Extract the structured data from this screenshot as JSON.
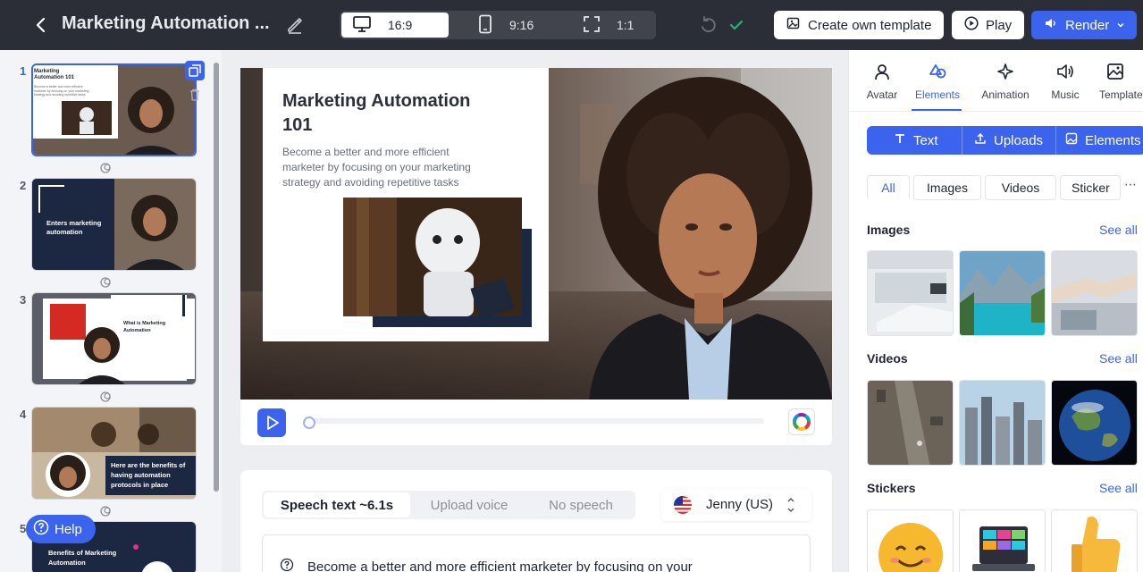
{
  "header": {
    "title": "Marketing Automation ...",
    "ratios": [
      {
        "icon": "monitor-icon",
        "label": "16:9"
      },
      {
        "icon": "phone-icon",
        "label": "9:16"
      },
      {
        "icon": "square-frame-icon",
        "label": "1:1"
      }
    ],
    "active_ratio": "16:9",
    "create_template_label": "Create own template",
    "play_label": "Play",
    "render_label": "Render"
  },
  "slides": {
    "numbers": [
      "1",
      "2",
      "3",
      "4",
      "5"
    ],
    "slide1": {
      "title": "Marketing Automation 101",
      "body": "Become a better and more efficient marketer by focusing on your marketing strategy and avoiding repetitive tasks"
    },
    "slide2": {
      "title": "Enters marketing automation"
    },
    "slide3": {
      "title": "What is Marketing Automation"
    },
    "slide4": {
      "title": "Here are the benefits of having automation protocols in place"
    },
    "slide5": {
      "title": "Benefits of Marketing Automation"
    },
    "help_label": "Help"
  },
  "canvas": {
    "title": "Marketing Automation 101",
    "subtitle": "Become a better and more efficient marketer by focusing on your marketing strategy and avoiding repetitive tasks"
  },
  "playback": {
    "progress": 0
  },
  "speech": {
    "tabs": [
      "Speech text ~6.1s",
      "Upload voice",
      "No speech"
    ],
    "active_tab": "Speech text ~6.1s",
    "voice": "Jenny (US)",
    "text": "Become a better and more efficient marketer by focusing on your"
  },
  "panel": {
    "tabs": [
      {
        "icon": "avatar-icon",
        "label": "Avatar"
      },
      {
        "icon": "elements-icon",
        "label": "Elements"
      },
      {
        "icon": "animation-icon",
        "label": "Animation"
      },
      {
        "icon": "music-icon",
        "label": "Music"
      },
      {
        "icon": "template-icon",
        "label": "Template"
      }
    ],
    "active_tab": "Elements",
    "segments": [
      "Text",
      "Uploads",
      "Elements"
    ],
    "filters": [
      "All",
      "Images",
      "Videos",
      "Sticker"
    ],
    "active_filter": "All",
    "sections": {
      "images": "Images",
      "videos": "Videos",
      "stickers": "Stickers",
      "see_all": "See all"
    }
  },
  "colors": {
    "accent": "#3b63ee",
    "topbar": "#2b2e36",
    "navy": "#1c2742",
    "success": "#22b573"
  }
}
